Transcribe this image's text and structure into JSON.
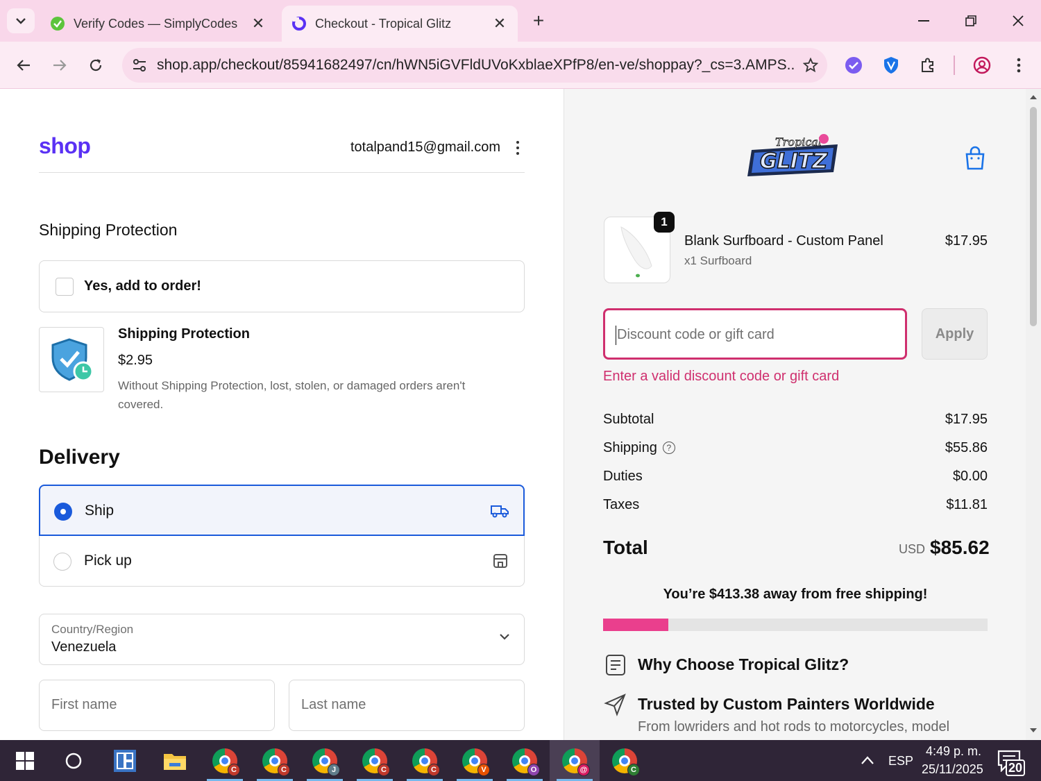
{
  "browser": {
    "tabs": [
      {
        "title": "Verify Codes — SimplyCodes",
        "active": false,
        "favicon": "simplycodes-icon"
      },
      {
        "title": "Checkout - Tropical Glitz",
        "active": true,
        "favicon": "shop-icon"
      }
    ],
    "url": "shop.app/checkout/85941682497/cn/hWN5iGVFldUVoKxblaeXPfP8/en-ve/shoppay?_cs=3.AMPS...",
    "accent_color": "#f9d7ea"
  },
  "checkout": {
    "brand": "shop",
    "account_email": "totalpand15@gmail.com",
    "shipping_protection": {
      "section_title": "Shipping Protection",
      "checkbox_label": "Yes, add to order!",
      "checked": false,
      "name": "Shipping Protection",
      "price": "$2.95",
      "description": "Without Shipping Protection, lost, stolen, or damaged orders aren't covered."
    },
    "delivery": {
      "title": "Delivery",
      "options": [
        {
          "label": "Ship",
          "selected": true,
          "icon": "truck-icon"
        },
        {
          "label": "Pick up",
          "selected": false,
          "icon": "store-icon"
        }
      ]
    },
    "country": {
      "label": "Country/Region",
      "value": "Venezuela"
    },
    "first_name_placeholder": "First name",
    "last_name_placeholder": "Last name"
  },
  "summary": {
    "product": {
      "name": "Blank Surfboard - Custom Panel",
      "variant": "x1 Surfboard",
      "price": "$17.95",
      "quantity": "1"
    },
    "discount_placeholder": "Discount code or gift card",
    "apply_label": "Apply",
    "error": "Enter a valid discount code or gift card",
    "lines": [
      {
        "label": "Subtotal",
        "value": "$17.95"
      },
      {
        "label": "Shipping",
        "value": "$55.86",
        "help": true
      },
      {
        "label": "Duties",
        "value": "$0.00"
      },
      {
        "label": "Taxes",
        "value": "$11.81"
      }
    ],
    "total_label": "Total",
    "currency": "USD",
    "total": "$85.62",
    "free_shipping_message": "You’re $413.38 away from free shipping!",
    "free_shipping_progress_fraction": 0.17,
    "progress_color": "#ea3f8d",
    "why_title": "Why Choose Tropical Glitz?",
    "trust_title": "Trusted by Custom Painters Worldwide",
    "trust_subtitle": "From lowriders and hot rods to motorcycles, model",
    "error_color": "#cf2f6e"
  },
  "taskbar": {
    "apps": [
      {
        "name": "start-button"
      },
      {
        "name": "search-button"
      },
      {
        "name": "task-view-button"
      },
      {
        "name": "file-explorer"
      },
      {
        "name": "chrome",
        "profile": "C",
        "profile_color": "#c0392b"
      },
      {
        "name": "chrome",
        "profile": "C",
        "profile_color": "#c0392b"
      },
      {
        "name": "chrome",
        "profile": "J",
        "profile_color": "#607d8b"
      },
      {
        "name": "chrome",
        "profile": "C",
        "profile_color": "#c0392b"
      },
      {
        "name": "chrome",
        "profile": "C",
        "profile_color": "#c0392b"
      },
      {
        "name": "chrome",
        "profile": "V",
        "profile_color": "#e65100"
      },
      {
        "name": "chrome",
        "profile": "O",
        "profile_color": "#8e44ad"
      },
      {
        "name": "chrome",
        "profile": "@",
        "profile_color": "#d81b60",
        "active": true
      },
      {
        "name": "chrome",
        "profile": "C",
        "profile_color": "#2e7d32"
      }
    ],
    "language": "ESP",
    "time": "4:49 p. m.",
    "date": "25/11/2025",
    "notifications": "20"
  }
}
